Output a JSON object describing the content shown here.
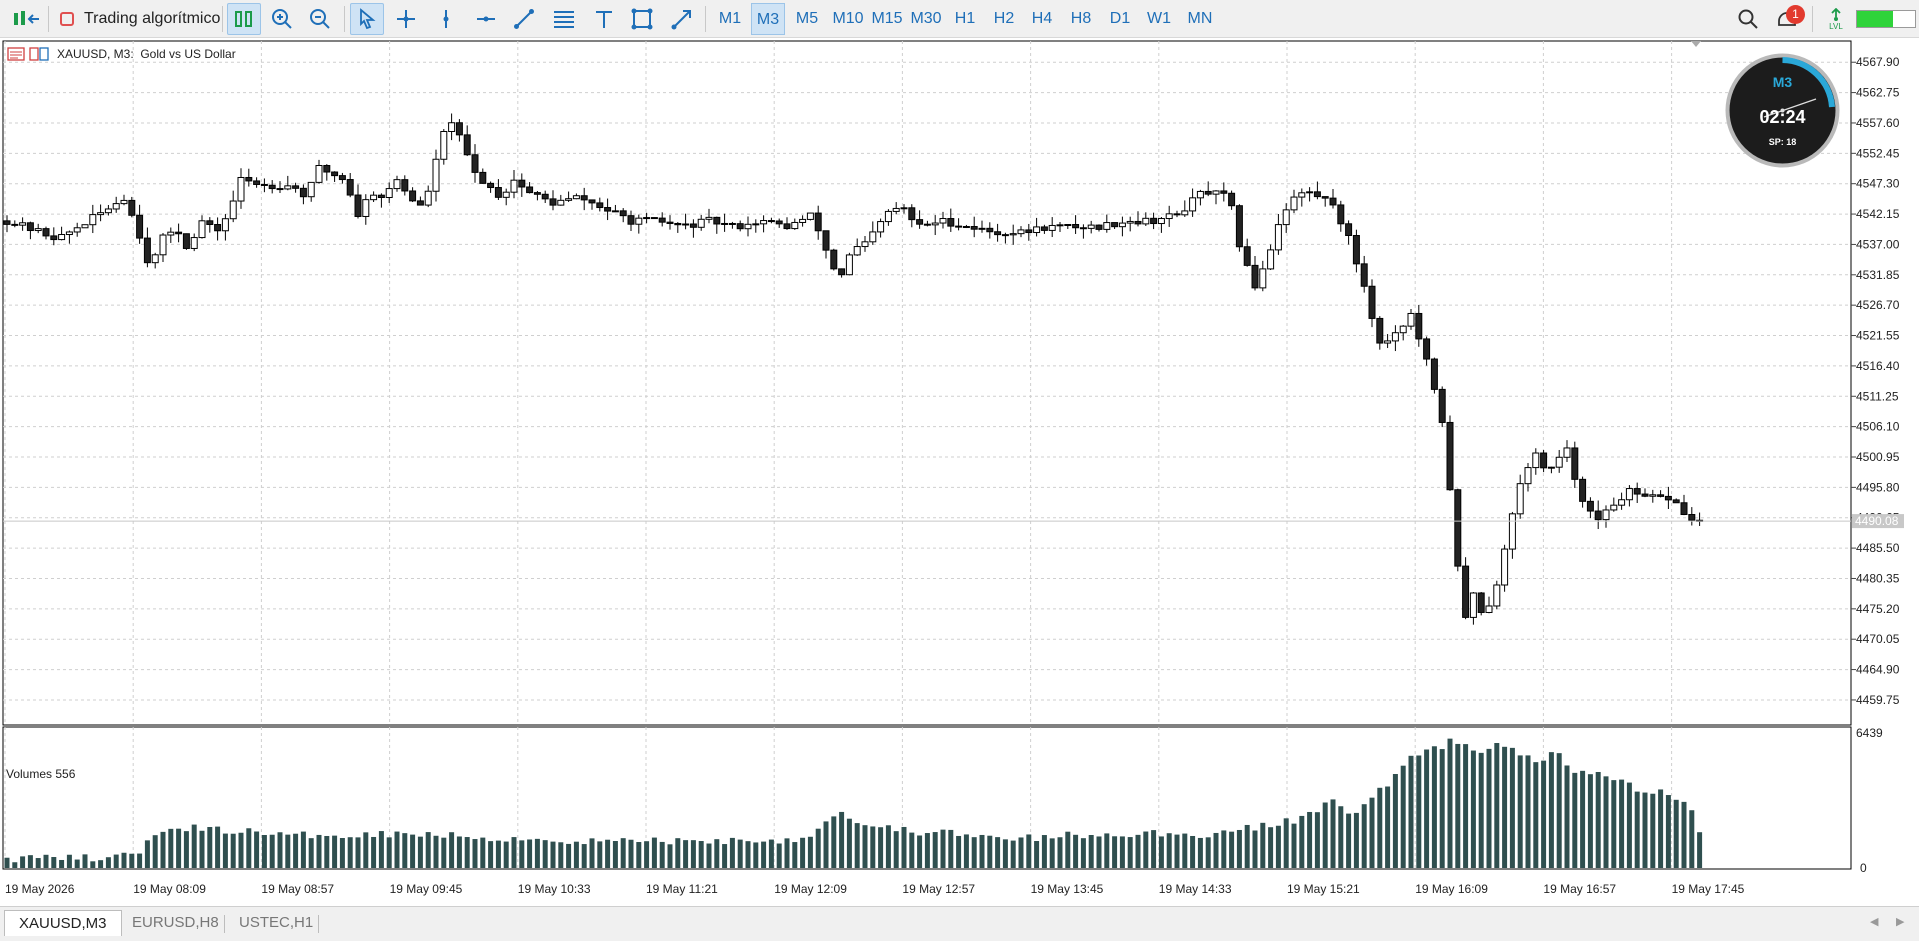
{
  "toolbar": {
    "algo_label": "Trading algorítmico",
    "timeframes": [
      "M1",
      "M3",
      "M5",
      "M10",
      "M15",
      "M30",
      "H1",
      "H2",
      "H4",
      "H8",
      "D1",
      "W1",
      "MN"
    ],
    "active_timeframe": "M3",
    "notification_count": "1",
    "lvl_label": "LVL"
  },
  "chart": {
    "title": "XAUUSD, M3:  Gold vs US Dollar",
    "current_price": "4490.08",
    "price_ticks": [
      "4567.90",
      "4562.75",
      "4557.60",
      "4552.45",
      "4547.30",
      "4542.15",
      "4537.00",
      "4531.85",
      "4526.70",
      "4521.55",
      "4516.40",
      "4511.25",
      "4506.10",
      "4500.95",
      "4495.80",
      "4490.65",
      "4485.50",
      "4480.35",
      "4475.20",
      "4470.05",
      "4464.90",
      "4459.75"
    ],
    "time_ticks": [
      "19 May 2026",
      "19 May 08:09",
      "19 May 08:57",
      "19 May 09:45",
      "19 May 10:33",
      "19 May 11:21",
      "19 May 12:09",
      "19 May 12:57",
      "19 May 13:45",
      "19 May 14:33",
      "19 May 15:21",
      "19 May 16:09",
      "19 May 16:57",
      "19 May 17:45"
    ],
    "volume_label": "Volumes 556",
    "volume_max_label": "6439",
    "volume_min_label": "0",
    "up_color": "#ffffff",
    "down_color": "#222222",
    "volume_color": "#2f4f4f"
  },
  "timer": {
    "timeframe": "M3",
    "time": "02:24",
    "spread": "SP: 18"
  },
  "tabs": [
    {
      "label": "XAUUSD,M3"
    },
    {
      "label": "EURUSD,H8"
    },
    {
      "label": "USTEC,H1"
    }
  ],
  "chart_data": {
    "type": "candlestick",
    "title": "XAUUSD, M3:  Gold vs US Dollar",
    "ylim": [
      4455.5,
      4571.5
    ],
    "close_path": [
      [
        0,
        4541
      ],
      [
        20,
        4538
      ],
      [
        35,
        4542
      ],
      [
        45,
        4545
      ],
      [
        50,
        4540
      ],
      [
        55,
        4533
      ],
      [
        60,
        4538
      ],
      [
        65,
        4540
      ],
      [
        70,
        4536
      ],
      [
        75,
        4541
      ],
      [
        80,
        4539
      ],
      [
        85,
        4542
      ],
      [
        90,
        4548
      ],
      [
        100,
        4547
      ],
      [
        110,
        4547
      ],
      [
        115,
        4545
      ],
      [
        120,
        4550
      ],
      [
        125,
        4549
      ],
      [
        130,
        4548
      ],
      [
        135,
        4542
      ],
      [
        140,
        4546
      ],
      [
        145,
        4545
      ],
      [
        150,
        4548
      ],
      [
        155,
        4545
      ],
      [
        160,
        4543
      ],
      [
        165,
        4551
      ],
      [
        170,
        4559
      ],
      [
        175,
        4554
      ],
      [
        180,
        4549
      ],
      [
        185,
        4547
      ],
      [
        190,
        4545
      ],
      [
        195,
        4548
      ],
      [
        200,
        4546
      ],
      [
        210,
        4544
      ],
      [
        220,
        4545
      ],
      [
        230,
        4543
      ],
      [
        240,
        4541
      ],
      [
        250,
        4541
      ],
      [
        260,
        4540
      ],
      [
        270,
        4541
      ],
      [
        280,
        4540
      ],
      [
        290,
        4541
      ],
      [
        300,
        4540
      ],
      [
        310,
        4542
      ],
      [
        315,
        4536
      ],
      [
        320,
        4531
      ],
      [
        325,
        4536
      ],
      [
        330,
        4537
      ],
      [
        335,
        4540
      ],
      [
        340,
        4543
      ],
      [
        345,
        4543
      ],
      [
        350,
        4540
      ],
      [
        360,
        4541
      ],
      [
        370,
        4540
      ],
      [
        380,
        4539
      ],
      [
        390,
        4539
      ],
      [
        400,
        4540
      ],
      [
        410,
        4540
      ],
      [
        420,
        4540
      ],
      [
        430,
        4541
      ],
      [
        440,
        4541
      ],
      [
        450,
        4542
      ],
      [
        460,
        4546
      ],
      [
        470,
        4545
      ],
      [
        475,
        4535
      ],
      [
        480,
        4530
      ],
      [
        485,
        4535
      ],
      [
        490,
        4542
      ],
      [
        495,
        4545
      ],
      [
        500,
        4546
      ],
      [
        505,
        4545
      ],
      [
        510,
        4544
      ],
      [
        512,
        4542
      ],
      [
        516,
        4538
      ],
      [
        522,
        4530
      ],
      [
        528,
        4520
      ],
      [
        534,
        4522
      ],
      [
        540,
        4525
      ],
      [
        546,
        4517
      ],
      [
        552,
        4507
      ],
      [
        556,
        4492
      ],
      [
        560,
        4472
      ],
      [
        564,
        4478
      ],
      [
        568,
        4474
      ],
      [
        572,
        4478
      ],
      [
        576,
        4485
      ],
      [
        580,
        4494
      ],
      [
        584,
        4498
      ],
      [
        588,
        4502
      ],
      [
        592,
        4498
      ],
      [
        596,
        4500
      ],
      [
        600,
        4502
      ],
      [
        604,
        4496
      ],
      [
        608,
        4492
      ],
      [
        612,
        4490
      ],
      [
        616,
        4492
      ],
      [
        620,
        4494
      ],
      [
        624,
        4495
      ],
      [
        628,
        4494
      ],
      [
        632,
        4494
      ],
      [
        636,
        4494
      ],
      [
        640,
        4494
      ],
      [
        644,
        4492
      ],
      [
        648,
        4490
      ],
      [
        652,
        4490
      ]
    ],
    "volume_path": [
      [
        0,
        0.07
      ],
      [
        20,
        0.07
      ],
      [
        40,
        0.08
      ],
      [
        50,
        0.1
      ],
      [
        60,
        0.3
      ],
      [
        65,
        0.33
      ],
      [
        70,
        0.3
      ],
      [
        80,
        0.29
      ],
      [
        90,
        0.28
      ],
      [
        100,
        0.26
      ],
      [
        110,
        0.24
      ],
      [
        120,
        0.25
      ],
      [
        140,
        0.26
      ],
      [
        160,
        0.26
      ],
      [
        180,
        0.23
      ],
      [
        200,
        0.22
      ],
      [
        220,
        0.2
      ],
      [
        240,
        0.21
      ],
      [
        260,
        0.2
      ],
      [
        280,
        0.21
      ],
      [
        300,
        0.21
      ],
      [
        310,
        0.26
      ],
      [
        315,
        0.35
      ],
      [
        320,
        0.43
      ],
      [
        325,
        0.38
      ],
      [
        330,
        0.32
      ],
      [
        340,
        0.3
      ],
      [
        350,
        0.27
      ],
      [
        360,
        0.27
      ],
      [
        370,
        0.24
      ],
      [
        380,
        0.22
      ],
      [
        390,
        0.22
      ],
      [
        400,
        0.23
      ],
      [
        410,
        0.25
      ],
      [
        420,
        0.23
      ],
      [
        430,
        0.26
      ],
      [
        440,
        0.26
      ],
      [
        450,
        0.25
      ],
      [
        460,
        0.25
      ],
      [
        470,
        0.28
      ],
      [
        480,
        0.3
      ],
      [
        490,
        0.34
      ],
      [
        500,
        0.38
      ],
      [
        505,
        0.46
      ],
      [
        510,
        0.5
      ],
      [
        515,
        0.44
      ],
      [
        520,
        0.42
      ],
      [
        525,
        0.55
      ],
      [
        530,
        0.6
      ],
      [
        535,
        0.72
      ],
      [
        540,
        0.82
      ],
      [
        545,
        0.87
      ],
      [
        550,
        0.9
      ],
      [
        555,
        0.95
      ],
      [
        560,
        0.96
      ],
      [
        565,
        0.9
      ],
      [
        570,
        0.88
      ],
      [
        575,
        0.93
      ],
      [
        580,
        0.86
      ],
      [
        585,
        0.84
      ],
      [
        590,
        0.8
      ],
      [
        595,
        0.92
      ],
      [
        600,
        0.8
      ],
      [
        605,
        0.7
      ],
      [
        610,
        0.72
      ],
      [
        615,
        0.66
      ],
      [
        620,
        0.7
      ],
      [
        625,
        0.62
      ],
      [
        630,
        0.56
      ],
      [
        635,
        0.57
      ],
      [
        640,
        0.57
      ],
      [
        645,
        0.5
      ],
      [
        650,
        0.44
      ],
      [
        652,
        0.12
      ]
    ]
  }
}
